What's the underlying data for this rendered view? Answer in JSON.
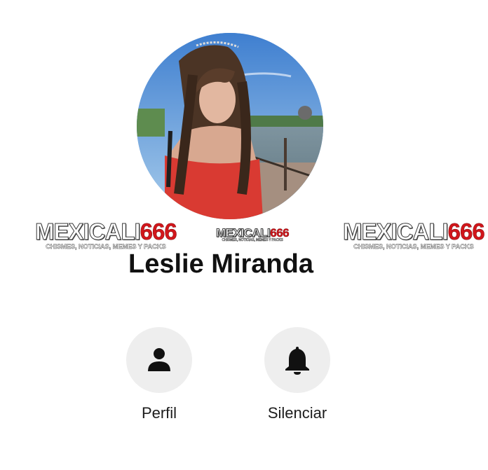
{
  "profile": {
    "name": "Leslie Miranda"
  },
  "watermark": {
    "brand_prefix": "MEXICALI",
    "brand_number": "666",
    "tagline": "CHISMES, NOTICIAS, MEMES Y PACKS",
    "brand_color": "#d2161b"
  },
  "actions": [
    {
      "label": "Perfil",
      "icon": "person-icon"
    },
    {
      "label": "Silenciar",
      "icon": "bell-icon"
    }
  ],
  "colors": {
    "action_circle_bg": "#eeeeee",
    "name_text": "#111111"
  }
}
